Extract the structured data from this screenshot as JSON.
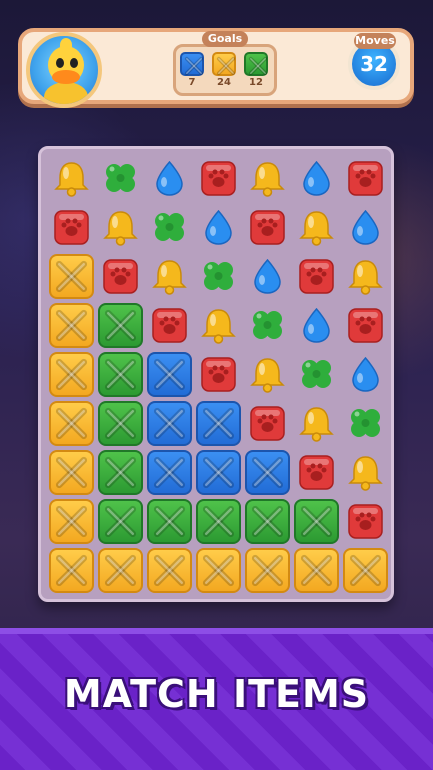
{
  "header": {
    "goals_label": "Goals",
    "moves_label": "Moves",
    "moves_value": "32",
    "goals": [
      {
        "color": "blue",
        "count": "7"
      },
      {
        "color": "orange",
        "count": "24"
      },
      {
        "color": "green",
        "count": "12"
      }
    ]
  },
  "colors": {
    "orange": "#f3a821",
    "green": "#2c9a32",
    "blue": "#226cd6",
    "red": "#e03a3a",
    "drop": "#2a8ef0",
    "bell": "#f5b81c",
    "clover": "#2fae3c"
  },
  "board": {
    "rows": [
      [
        "bell",
        "clover",
        "drop",
        "red",
        "bell",
        "drop",
        "red"
      ],
      [
        "red",
        "bell",
        "clover",
        "drop",
        "red",
        "bell",
        "drop"
      ],
      [
        "orange",
        "red",
        "bell",
        "clover",
        "drop",
        "red",
        "bell"
      ],
      [
        "orange",
        "green",
        "red",
        "bell",
        "clover",
        "drop",
        "red"
      ],
      [
        "orange",
        "green",
        "blue",
        "red",
        "bell",
        "clover",
        "drop"
      ],
      [
        "orange",
        "green",
        "blue",
        "blue",
        "red",
        "bell",
        "clover"
      ],
      [
        "orange",
        "green",
        "blue",
        "blue",
        "blue",
        "red",
        "bell"
      ],
      [
        "orange",
        "green",
        "green",
        "green",
        "green",
        "green",
        "red"
      ],
      [
        "orange",
        "orange",
        "orange",
        "orange",
        "orange",
        "orange",
        "orange"
      ]
    ]
  },
  "banner": {
    "text": "MATCH ITEMS"
  }
}
